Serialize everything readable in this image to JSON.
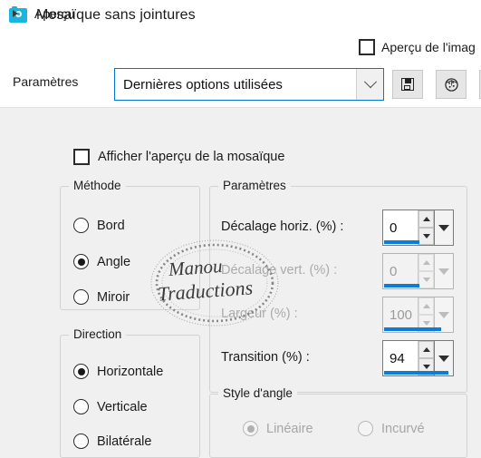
{
  "window": {
    "title": "Mosaïque sans jointures",
    "icon": "camera-icon"
  },
  "header": {
    "expander_label": "Aperçu",
    "expander_icon": "triangle-right-icon",
    "image_preview_label": "Aperçu de l'imag",
    "image_preview_checked": false
  },
  "settings_bar": {
    "label": "Paramètres",
    "preset_value": "Dernières options utilisées",
    "dropdown_icon": "chevron-down-icon",
    "buttons": [
      {
        "name": "save-preset-button",
        "icon": "floppy-disk-icon"
      },
      {
        "name": "randomize-button",
        "icon": "dice-icon"
      },
      {
        "name": "third-toolbar-button",
        "icon": "unknown-icon"
      }
    ]
  },
  "mosaic_preview": {
    "label": "Afficher l'aperçu de la mosaïque",
    "checked": false
  },
  "methode": {
    "title": "Méthode",
    "options": [
      {
        "label": "Bord",
        "selected": false,
        "disabled": false
      },
      {
        "label": "Angle",
        "selected": true,
        "disabled": false
      },
      {
        "label": "Miroir",
        "selected": false,
        "disabled": false
      }
    ]
  },
  "direction": {
    "title": "Direction",
    "options": [
      {
        "label": "Horizontale",
        "selected": true,
        "disabled": false
      },
      {
        "label": "Verticale",
        "selected": false,
        "disabled": false
      },
      {
        "label": "Bilatérale",
        "selected": false,
        "disabled": false
      }
    ]
  },
  "parametres": {
    "title": "Paramètres",
    "fields": [
      {
        "label": "Décalage horiz. (%) :",
        "value": "0",
        "disabled": false,
        "fill_pct": 52
      },
      {
        "label": "Décalage vert. (%) :",
        "value": "0",
        "disabled": true,
        "fill_pct": 52
      },
      {
        "label": "Largeur (%) :",
        "value": "100",
        "disabled": true,
        "fill_pct": 84
      },
      {
        "label": "Transition (%) :",
        "value": "94",
        "disabled": false,
        "fill_pct": 94
      }
    ]
  },
  "style_angle": {
    "title": "Style d'angle",
    "options": [
      {
        "label": "Linéaire",
        "selected": true,
        "disabled": true
      },
      {
        "label": "Incurvé",
        "selected": false,
        "disabled": true
      }
    ]
  },
  "watermark": {
    "line1": "Manou",
    "line2": "Traductions"
  },
  "colors": {
    "accent": "#0c7cd5",
    "focus_border": "#0078d7",
    "app_icon": "#1ab4e0",
    "background": "#f0f0f0"
  }
}
